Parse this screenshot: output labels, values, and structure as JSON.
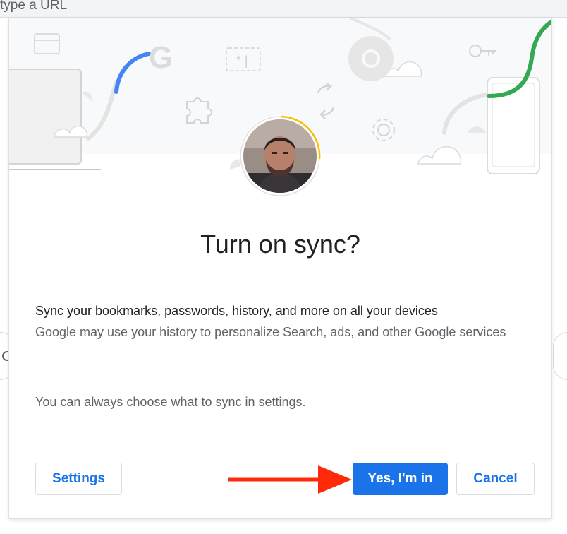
{
  "browser": {
    "omnibox_text": "type a URL"
  },
  "dialog": {
    "title": "Turn on sync?",
    "body_main": "Sync your bookmarks, passwords, history, and more on all your devices",
    "body_sub": "Google may use your history to personalize Search, ads, and other Google services",
    "note": "You can always choose what to sync in settings.",
    "buttons": {
      "settings": "Settings",
      "confirm": "Yes, I'm in",
      "cancel": "Cancel"
    },
    "banner_text": {
      "google_letter": "G",
      "password_text": "*|"
    }
  },
  "colors": {
    "primary": "#1a73e8",
    "google_blue": "#4285f4",
    "google_green": "#34a853",
    "google_yellow": "#fbbc04",
    "arrow_red": "#ff2a0a"
  },
  "icons": [
    "credit-card-icon",
    "google-g-icon",
    "password-icon",
    "chrome-icon",
    "key-icon",
    "puzzle-icon",
    "sync-icon",
    "gear-icon",
    "laptop-icon",
    "phone-icon",
    "cloud-icon",
    "search-icon",
    "arrow-icon"
  ]
}
